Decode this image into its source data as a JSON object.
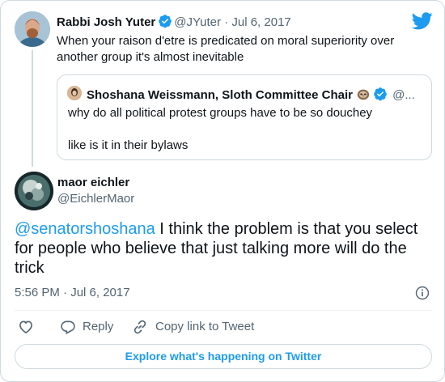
{
  "colors": {
    "accent": "#1d9bf0",
    "muted": "#536471",
    "text": "#0f1419",
    "border": "#cfd9de"
  },
  "parent_tweet": {
    "author_name": "Rabbi Josh Yuter",
    "handle": "@JYuter",
    "separator": "·",
    "date": "Jul 6, 2017",
    "text": "When your raison d'etre is predicated on moral superiority over another group it's almost inevitable",
    "quoted_tweet": {
      "author_name": "Shoshana Weissmann, Sloth Committee Chair",
      "handle": "@...",
      "emoji_icon": "sloth-icon",
      "text_line1": "why do all political protest groups have to be so douchey",
      "text_line2": "like is it in their bylaws"
    }
  },
  "main_tweet": {
    "author_name": "maor eichler",
    "handle": "@EichlerMaor",
    "mention": "@senatorshoshana",
    "text": " I think the problem is that you select for people who believe that just talking more will do the trick",
    "timestamp": "5:56 PM · Jul 6, 2017"
  },
  "actions": {
    "reply_label": "Reply",
    "copy_link_label": "Copy link to Tweet",
    "explore_label": "Explore what's happening on Twitter"
  },
  "icons": [
    "twitter-logo-icon",
    "verified-badge-icon",
    "sloth-icon",
    "info-icon",
    "heart-icon",
    "reply-icon",
    "link-icon"
  ]
}
